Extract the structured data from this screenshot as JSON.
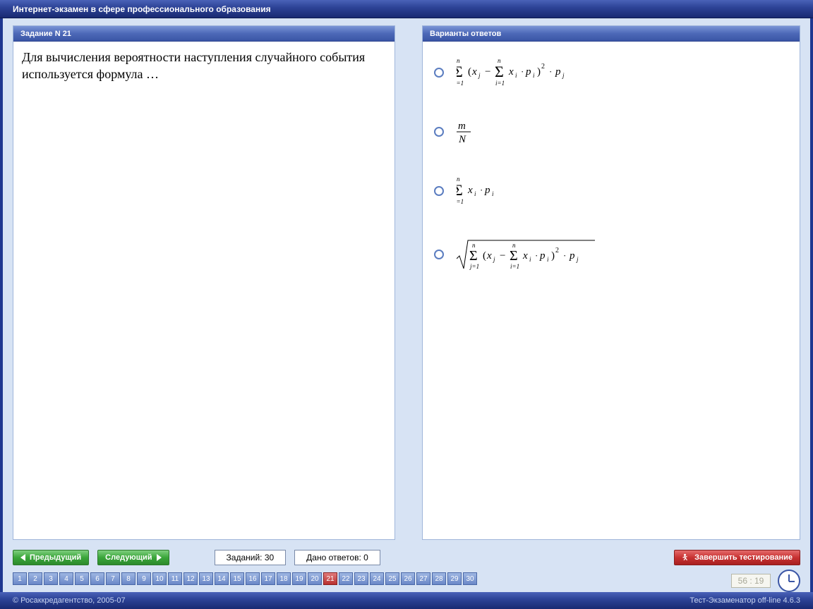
{
  "titlebar": "Интернет-экзамен в сфере профессионального образования",
  "question": {
    "header": "Задание N 21",
    "text": "Для вычисления вероятности наступления случайного события используется формула  …"
  },
  "answers": {
    "header": "Варианты ответов"
  },
  "nav": {
    "prev": "Предыдущий",
    "next": "Следующий",
    "total": "Заданий: 30",
    "answered": "Дано ответов: 0",
    "finish": "Завершить тестирование",
    "current_question": 21,
    "total_questions": 30,
    "timer": "56 : 19"
  },
  "footer": {
    "left": "© Росаккредагентство, 2005-07",
    "right": "Тест-Экзаменатор off-line 4.6.3"
  }
}
